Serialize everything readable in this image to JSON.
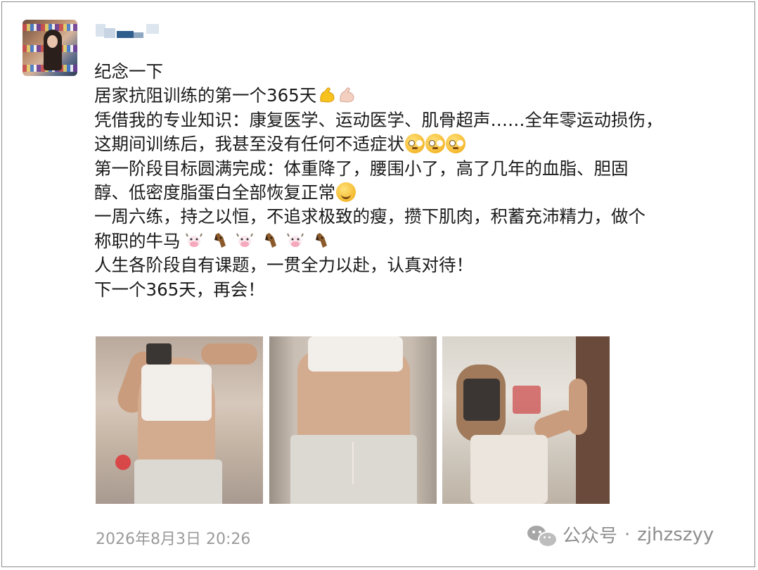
{
  "post": {
    "avatar_icon": "avatar-photo",
    "lines": [
      "纪念一下",
      "居家抗阻训练的第一个365天",
      "凭借我的专业知识：康复医学、运动医学、肌骨超声……全年零运动损伤，",
      "这期间训练后，我甚至没有任何不适症状",
      "第一阶段目标圆满完成：体重降了，腰围小了，高了几年的血脂、胆固",
      "醇、低密度脂蛋白全部恢复正常",
      "一周六练，持之以恒，不追求极致的瘦，攒下肌肉，积蓄充沛精力，做个",
      "称职的牛马",
      "人生各阶段自有课题，一贯全力以赴，认真对待！",
      "下一个365天，再会！"
    ],
    "timestamp": "2026年8月3日 20:26"
  },
  "watermark": {
    "label": "公众号",
    "separator": "·",
    "account": "zjhzszyy",
    "icon": "wechat-icon"
  },
  "colors": {
    "text": "#1a1a1a",
    "meta": "#9b9b9b",
    "border": "#8c8c8c"
  }
}
